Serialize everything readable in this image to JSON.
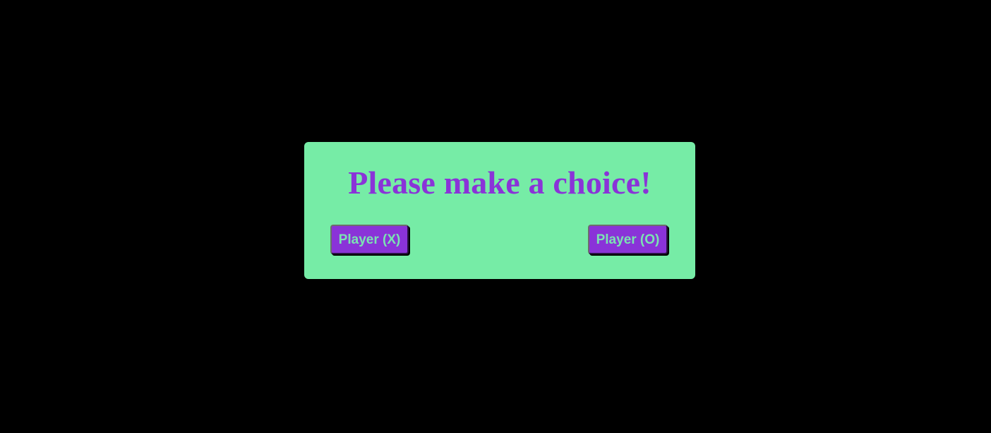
{
  "modal": {
    "title": "Please make a choice!",
    "buttons": {
      "player_x": "Player (X)",
      "player_o": "Player (O)"
    }
  },
  "colors": {
    "background": "#000000",
    "modal_bg": "#76ECA6",
    "accent_purple": "#8A33D8",
    "button_text": "#7BE3B2"
  }
}
